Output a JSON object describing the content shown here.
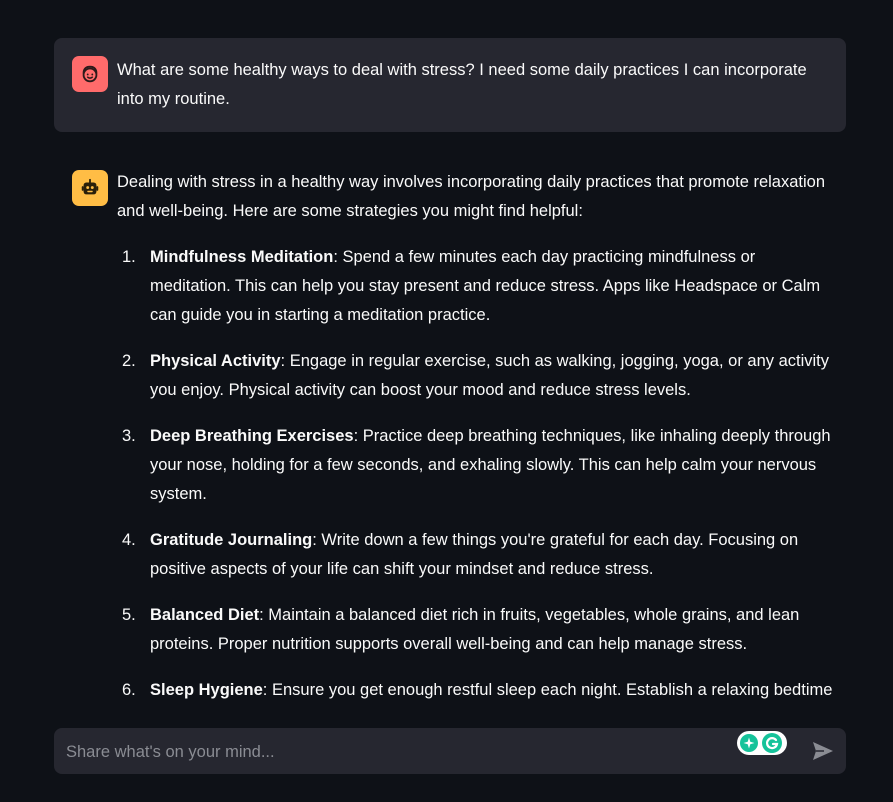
{
  "conversation": {
    "user_message": "What are some healthy ways to deal with stress? I need some daily practices I can incorporate into my routine.",
    "assistant_intro": "Dealing with stress in a healthy way involves incorporating daily practices that promote relaxation and well-being. Here are some strategies you might find helpful:",
    "tips": [
      {
        "number": "1.",
        "title": "Mindfulness Meditation",
        "text": ": Spend a few minutes each day practicing mindfulness or meditation. This can help you stay present and reduce stress. Apps like Headspace or Calm can guide you in starting a meditation practice."
      },
      {
        "number": "2.",
        "title": "Physical Activity",
        "text": ": Engage in regular exercise, such as walking, jogging, yoga, or any activity you enjoy. Physical activity can boost your mood and reduce stress levels."
      },
      {
        "number": "3.",
        "title": "Deep Breathing Exercises",
        "text": ": Practice deep breathing techniques, like inhaling deeply through your nose, holding for a few seconds, and exhaling slowly. This can help calm your nervous system."
      },
      {
        "number": "4.",
        "title": "Gratitude Journaling",
        "text": ": Write down a few things you're grateful for each day. Focusing on positive aspects of your life can shift your mindset and reduce stress."
      },
      {
        "number": "5.",
        "title": "Balanced Diet",
        "text": ": Maintain a balanced diet rich in fruits, vegetables, whole grains, and lean proteins. Proper nutrition supports overall well-being and can help manage stress."
      },
      {
        "number": "6.",
        "title": "Sleep Hygiene",
        "text": ": Ensure you get enough restful sleep each night. Establish a relaxing bedtime"
      }
    ]
  },
  "chat_input": {
    "placeholder": "Share what's on your mind..."
  },
  "icons": {
    "user_avatar": "user-face-icon",
    "assistant_avatar": "robot-icon",
    "send": "send-icon",
    "extension": "grammarly-icon"
  },
  "colors": {
    "background": "#0e1117",
    "message_bg": "#262730",
    "user_avatar_bg": "#ff6b6b",
    "assistant_avatar_bg": "#ffbd45",
    "extension_green": "#15c39a"
  }
}
